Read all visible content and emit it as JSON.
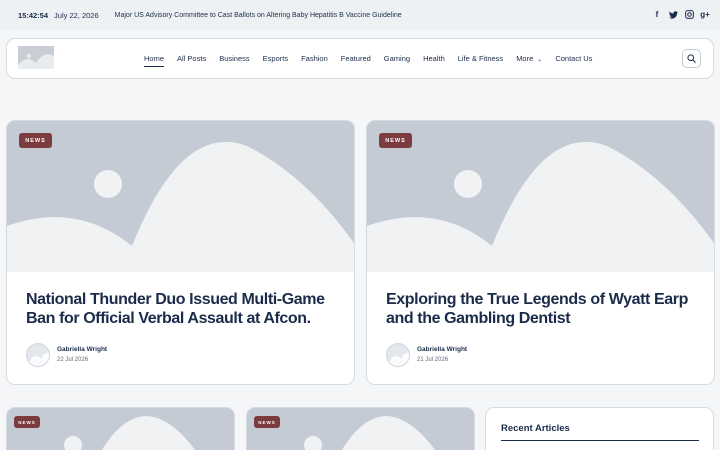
{
  "topbar": {
    "time": "15:42:54",
    "date": "July 22, 2026",
    "ticker": "Major US Advisory Committee to Cast Ballots on Altering Baby Hepatitis B Vaccine Guideline",
    "social": [
      {
        "icon": "facebook-icon",
        "glyph": "f"
      },
      {
        "icon": "twitter-icon",
        "glyph": "t"
      },
      {
        "icon": "instagram-icon",
        "glyph": "◎"
      },
      {
        "icon": "google-plus-icon",
        "glyph": "g+"
      }
    ]
  },
  "nav": {
    "items": [
      "Home",
      "All Posts",
      "Business",
      "Esports",
      "Fashion",
      "Featured",
      "Gaming",
      "Health",
      "Life & Fitness",
      "More",
      "Contact Us"
    ],
    "active": "Home"
  },
  "featured": [
    {
      "category": "NEWS",
      "title": "National Thunder Duo Issued Multi-Game Ban for Official Verbal Assault at Afcon.",
      "author": "Gabriella Wright",
      "date": "22 Jul 2026"
    },
    {
      "category": "NEWS",
      "title": "Exploring the True Legends of Wyatt Earp and the Gambling Dentist",
      "author": "Gabriella Wright",
      "date": "21 Jul 2026"
    }
  ],
  "small_cards": [
    {
      "category": "NEWS"
    },
    {
      "category": "NEWS"
    }
  ],
  "sidebar": {
    "recent_heading": "Recent Articles"
  },
  "colors": {
    "badge": "#7c3b3e",
    "text": "#1b2c4a",
    "placeholder": "#c4cbd4"
  }
}
